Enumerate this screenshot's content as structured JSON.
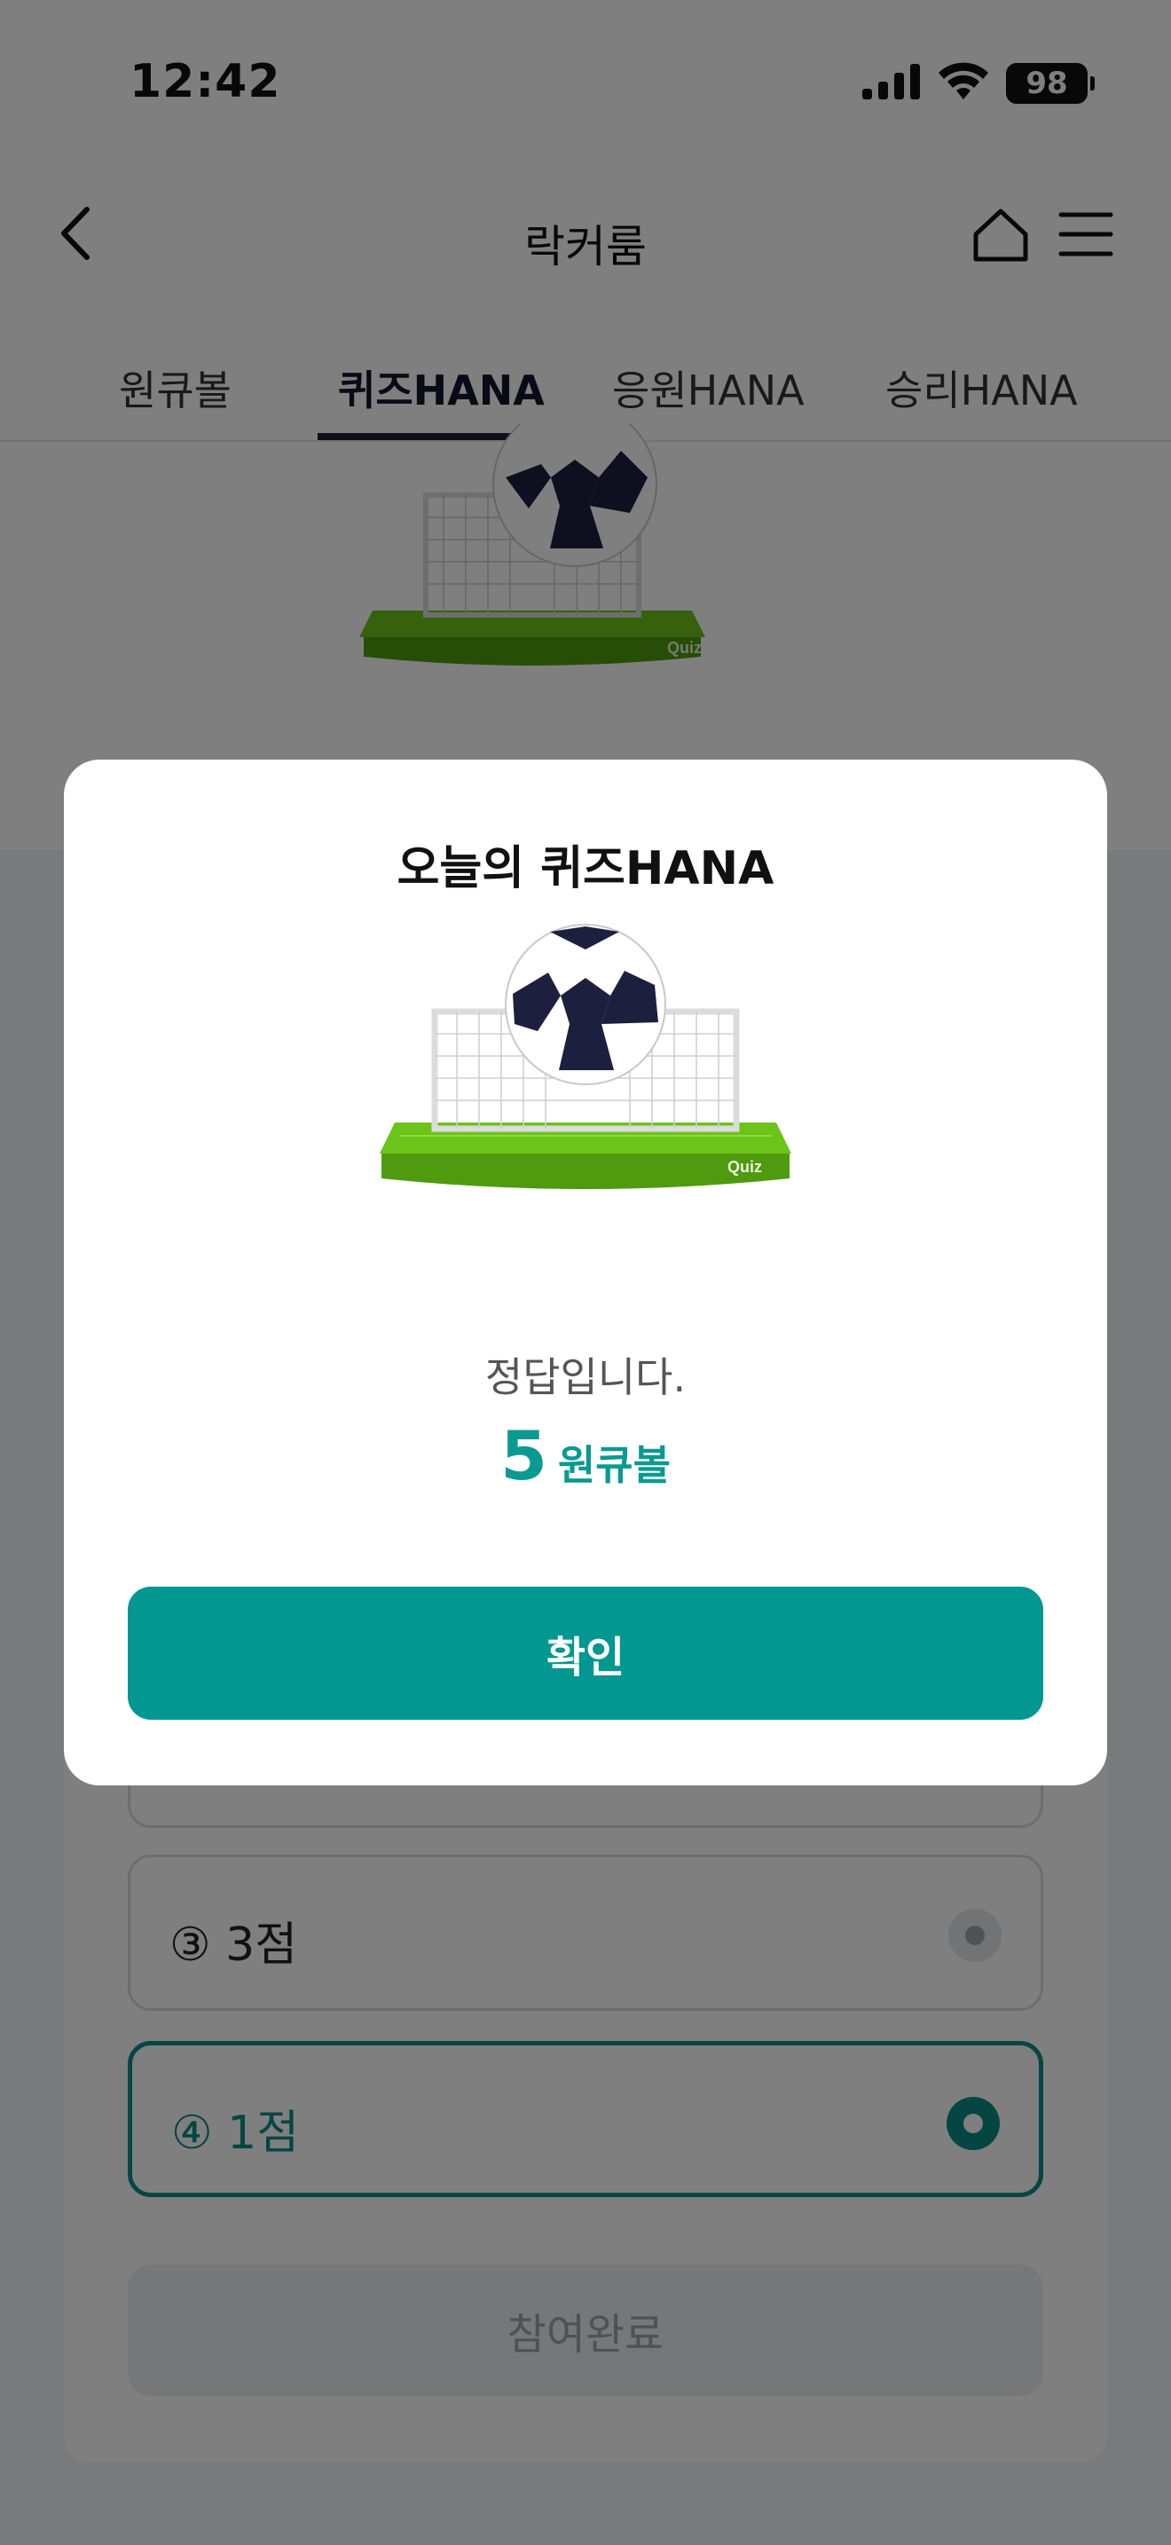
{
  "status_bar": {
    "time": "12:42",
    "battery": "98"
  },
  "header": {
    "title": "락커룸",
    "back_icon": "chevron-left-icon",
    "home_icon": "home-icon",
    "menu_icon": "hamburger-menu-icon"
  },
  "tabs": [
    {
      "label": "원큐볼",
      "active": false
    },
    {
      "label": "퀴즈HANA",
      "active": true
    },
    {
      "label": "응원HANA",
      "active": false
    },
    {
      "label": "승리HANA",
      "active": false
    }
  ],
  "background_page": {
    "banner_badge": "Quiz",
    "options": [
      {
        "label": "③ 3점",
        "selected": false
      },
      {
        "label": "④ 1점",
        "selected": true
      }
    ],
    "submit_label": "참여완료"
  },
  "modal": {
    "title": "오늘의 퀴즈HANA",
    "illustration_badge": "Quiz",
    "message": "정답입니다.",
    "reward_amount": "5",
    "reward_unit": "원큐볼",
    "confirm_label": "확인"
  },
  "colors": {
    "accent": "#039792",
    "tab_indicator": "#1e1e38"
  }
}
